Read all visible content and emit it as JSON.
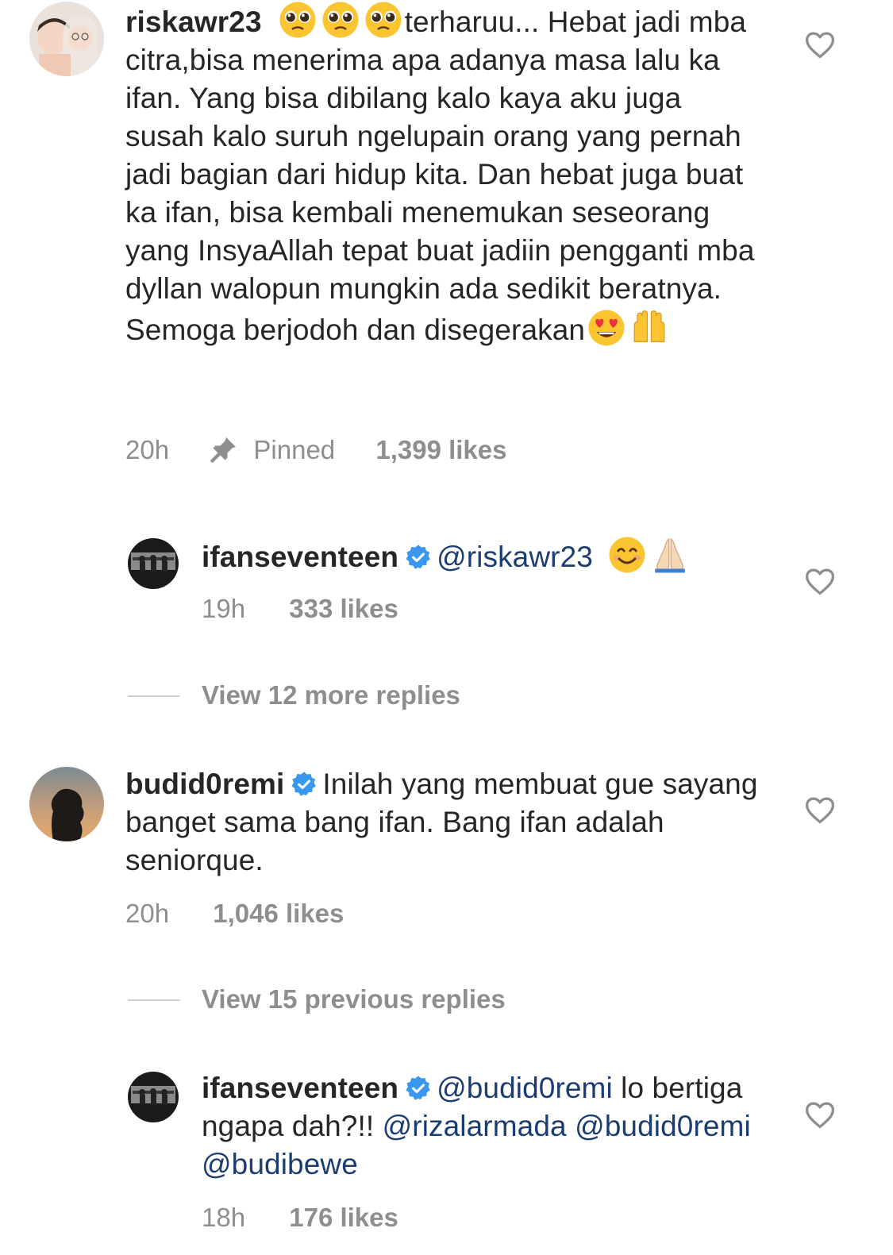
{
  "comments": [
    {
      "username": "riskawr23",
      "text_pre_emoji": "terharuu... Hebat jadi mba citra,bisa menerima apa adanya masa lalu ka ifan. Yang bisa dibilang kalo kaya aku juga susah kalo suruh ngelupain orang yang pernah jadi bagian dari hidup kita. Dan hebat juga buat ka ifan, bisa kembali menemukan seseorang yang InsyaAllah tepat buat jadiin pengganti mba dyllan walopun mungkin ada sedikit beratnya. Semoga berjodoh dan disegerakan",
      "emojis_start": [
        "pleading-face-emoji",
        "pleading-face-emoji",
        "pleading-face-emoji"
      ],
      "emojis_end": [
        "heart-eyes-emoji",
        "raising-hands-emoji"
      ],
      "time": "20h",
      "pinned_label": "Pinned",
      "likes": "1,399 likes"
    },
    {
      "username": "ifanseventeen",
      "verified": true,
      "mention": "@riskawr23",
      "emojis_end": [
        "smiling-face-emoji",
        "folded-hands-emoji"
      ],
      "time": "19h",
      "likes": "333 likes"
    },
    {
      "view_more": "View 12 more replies"
    },
    {
      "username": "budid0remi",
      "verified": true,
      "text": "Inilah yang membuat gue sayang banget sama bang ifan. Bang ifan adalah seniorque.",
      "time": "20h",
      "likes": "1,046 likes"
    },
    {
      "view_previous": "View 15 previous replies"
    },
    {
      "username": "ifanseventeen",
      "verified": true,
      "mention_1": "@budid0remi",
      "text_1": " lo bertiga ngapa dah?!! ",
      "mention_2": "@rizalarmada",
      "mention_3": "@budid0remi",
      "mention_4": "@budibewe",
      "time": "18h",
      "likes": "176 likes"
    }
  ],
  "icons": [
    "heart-outline-icon",
    "pin-icon",
    "verified-badge-icon"
  ],
  "colors": {
    "text": "#262626",
    "muted": "#8e8e8e",
    "mention": "#1c3d6f",
    "verified": "#3897f0"
  }
}
